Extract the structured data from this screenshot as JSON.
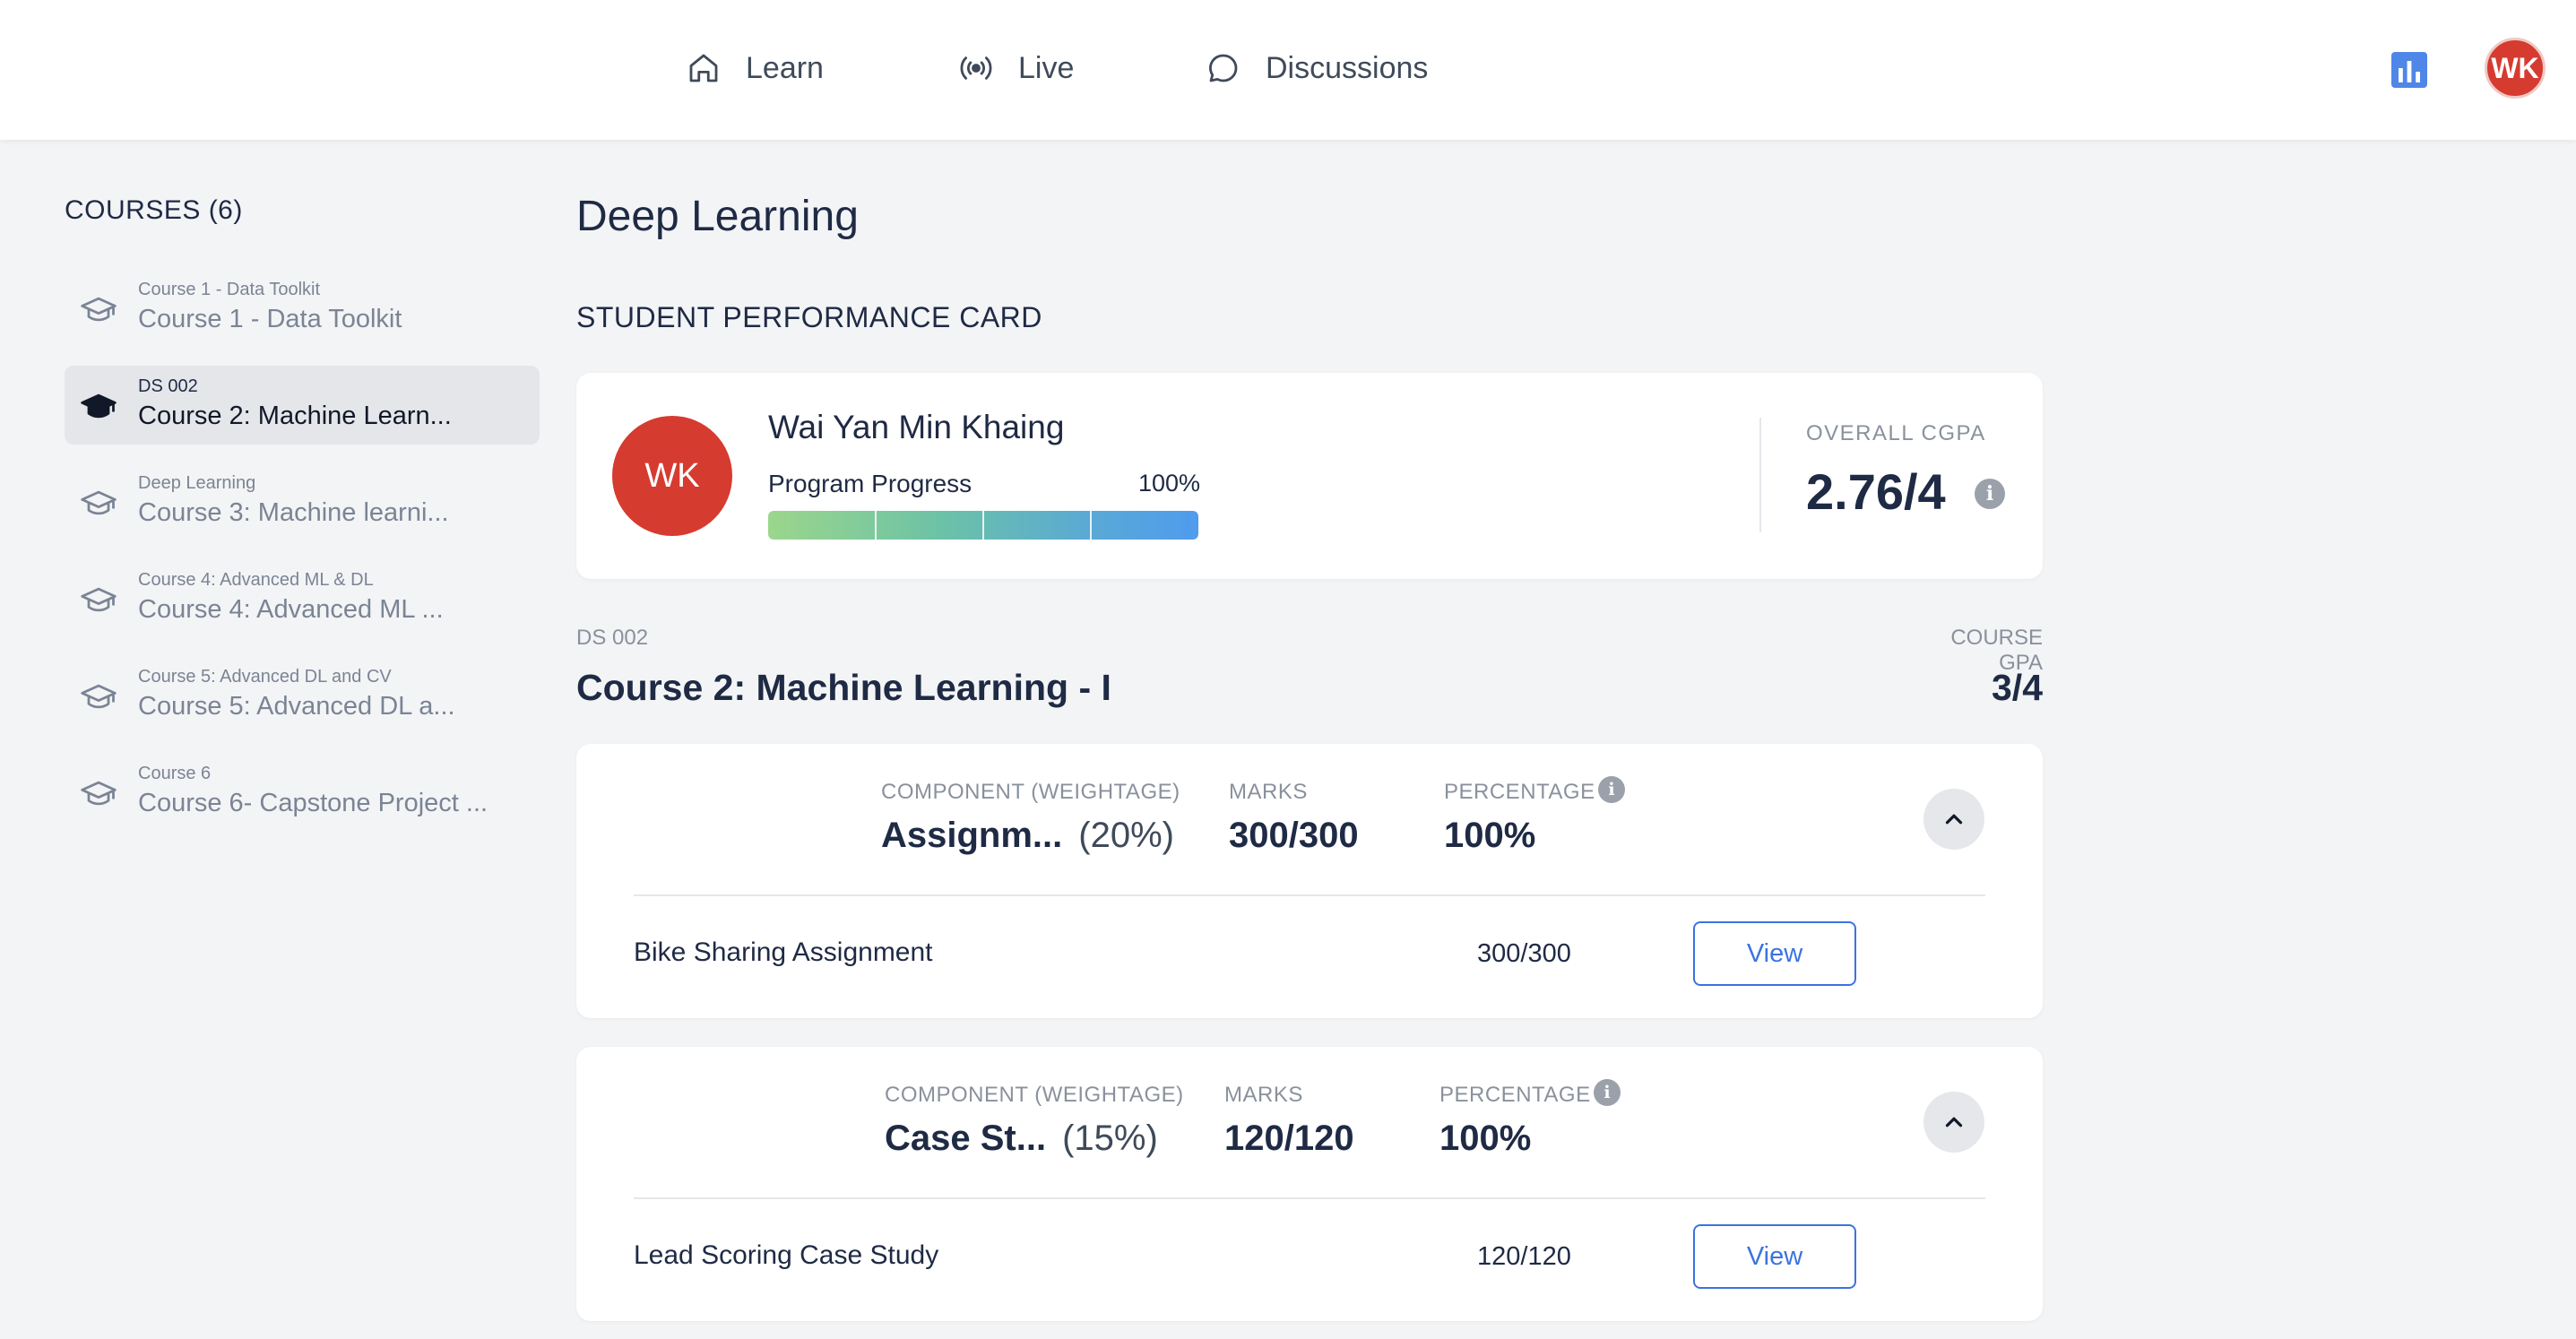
{
  "nav": {
    "items": [
      {
        "label": "Learn",
        "icon": "home-icon"
      },
      {
        "label": "Live",
        "icon": "broadcast-icon"
      },
      {
        "label": "Discussions",
        "icon": "chat-bubble-icon"
      }
    ],
    "stats_icon": "bar-chart-icon",
    "avatar_initials": "WK"
  },
  "sidebar": {
    "title": "COURSES (6)",
    "items": [
      {
        "sub": "Course 1 - Data Toolkit",
        "name": "Course 1 - Data Toolkit",
        "active": false
      },
      {
        "sub": "DS 002",
        "name": "Course 2: Machine Learn...",
        "active": true
      },
      {
        "sub": "Deep Learning",
        "name": "Course 3: Machine learni...",
        "active": false
      },
      {
        "sub": "Course 4: Advanced ML & DL",
        "name": "Course 4: Advanced ML ...",
        "active": false
      },
      {
        "sub": "Course 5: Advanced DL and CV",
        "name": "Course 5: Advanced DL a...",
        "active": false
      },
      {
        "sub": "Course 6",
        "name": "Course 6- Capstone Project ...",
        "active": false
      }
    ]
  },
  "main": {
    "page_title": "Deep Learning",
    "section_title": "STUDENT PERFORMANCE CARD",
    "student": {
      "initials": "WK",
      "name": "Wai Yan Min Khaing",
      "progress_label": "Program Progress",
      "progress_value": "100%",
      "progress_fraction": 1.0,
      "cgpa_label": "OVERALL CGPA",
      "cgpa_value": "2.76/4"
    },
    "course": {
      "code": "DS 002",
      "title": "Course 2: Machine Learning - I",
      "gpa_label": "COURSE GPA",
      "gpa_value": "3/4"
    },
    "component_headers": {
      "component": "COMPONENT (WEIGHTAGE)",
      "marks": "MARKS",
      "percentage": "PERCENTAGE"
    },
    "components": [
      {
        "name": "Assignm...",
        "weight": "(20%)",
        "marks": "300/300",
        "percentage": "100%",
        "row_name": "Bike Sharing Assignment",
        "row_marks": "300/300",
        "view_label": "View"
      },
      {
        "name": "Case St...",
        "weight": "(15%)",
        "marks": "120/120",
        "percentage": "100%",
        "row_name": "Lead Scoring Case Study",
        "row_marks": "120/120",
        "view_label": "View"
      }
    ]
  },
  "colors": {
    "accent_blue": "#3b73e0",
    "avatar_red": "#d63b30",
    "background": "#f3f4f6"
  }
}
